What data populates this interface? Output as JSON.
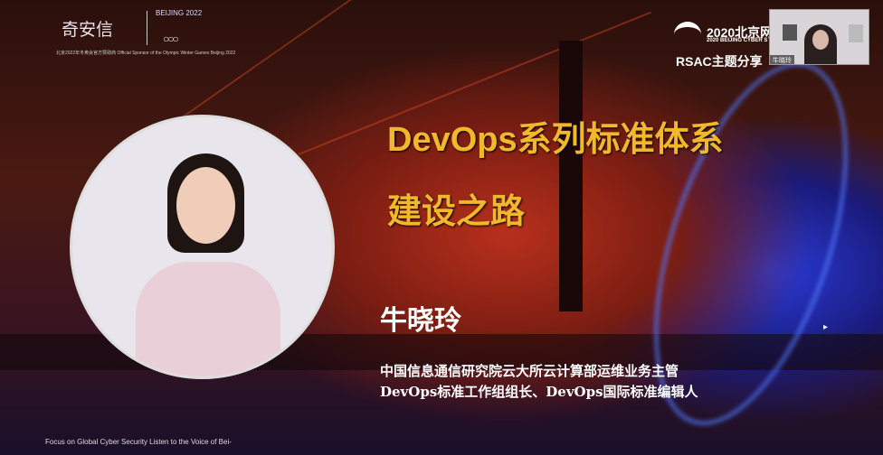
{
  "logo": {
    "brand": "奇安信",
    "olympic": "BEIJING 2022",
    "subtitle": "北京2022年冬奥会官方赞助商 Official Sponsor of the Olympic Winter Games Beijing 2022"
  },
  "event": {
    "title": "2020北京网",
    "subtitle": "2020 BEIJING CYBER S",
    "session": "RSAC主题分享"
  },
  "webcam": {
    "name": "牛晓玲"
  },
  "slide": {
    "title_line1": "DevOps系列标准体系",
    "title_line2": "建设之路",
    "speaker": "牛晓玲",
    "affiliation_line1": "中国信息通信研究院云大所云计算部运维业务主管",
    "affiliation_line2": "DevOps标准工作组组长、DevOps国际标准编辑人",
    "footer": "Focus on Global Cyber Security   Listen to the Voice of Bei-"
  }
}
